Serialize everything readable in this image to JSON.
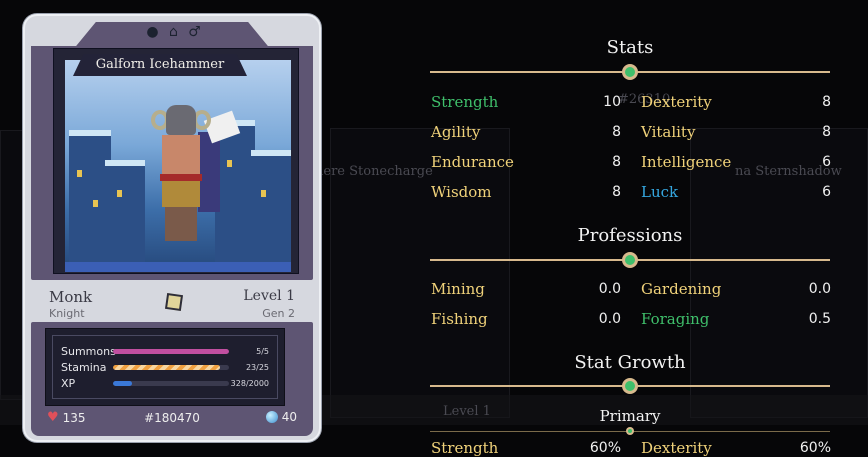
{
  "hero": {
    "name": "Galforn Icehammer",
    "header_icons": [
      "circle-icon",
      "house-icon",
      "male-icon"
    ],
    "class": "Monk",
    "subclass": "Knight",
    "level": "Level 1",
    "generation": "Gen 2",
    "bars": [
      {
        "label": "Summons",
        "value": "5/5",
        "fraction": 1.0,
        "color": "#c14fa0"
      },
      {
        "label": "Stamina",
        "value": "23/25",
        "fraction": 0.92,
        "color": "#f0a040"
      },
      {
        "label": "XP",
        "value": "328/2000",
        "fraction": 0.164,
        "color": "#3a78d8"
      }
    ],
    "hp": "135",
    "id": "#180470",
    "gems": "40"
  },
  "stats": {
    "title": "Stats",
    "items": [
      {
        "label": "Strength",
        "value": "10",
        "color": "#3fbf6b"
      },
      {
        "label": "Dexterity",
        "value": "8",
        "color": "#f0d27a"
      },
      {
        "label": "Agility",
        "value": "8",
        "color": "#f0d27a"
      },
      {
        "label": "Vitality",
        "value": "8",
        "color": "#f0d27a"
      },
      {
        "label": "Endurance",
        "value": "8",
        "color": "#f0d27a"
      },
      {
        "label": "Intelligence",
        "value": "6",
        "color": "#f0d27a"
      },
      {
        "label": "Wisdom",
        "value": "8",
        "color": "#f0d27a"
      },
      {
        "label": "Luck",
        "value": "6",
        "color": "#35a7e0"
      }
    ]
  },
  "professions": {
    "title": "Professions",
    "items": [
      {
        "label": "Mining",
        "value": "0.0",
        "color": "#f0d27a"
      },
      {
        "label": "Gardening",
        "value": "0.0",
        "color": "#f0d27a"
      },
      {
        "label": "Fishing",
        "value": "0.0",
        "color": "#f0d27a"
      },
      {
        "label": "Foraging",
        "value": "0.5",
        "color": "#3fbf6b"
      }
    ]
  },
  "growth": {
    "title": "Stat Growth",
    "subtitle": "Primary",
    "items": [
      {
        "label": "Strength",
        "value": "60%",
        "color": "#f0d27a"
      },
      {
        "label": "Dexterity",
        "value": "60%",
        "color": "#f0d27a"
      }
    ]
  },
  "background": {
    "labels": [
      "#26310",
      "here Stonecharge",
      "na Sternshadow",
      "Level 1"
    ]
  }
}
